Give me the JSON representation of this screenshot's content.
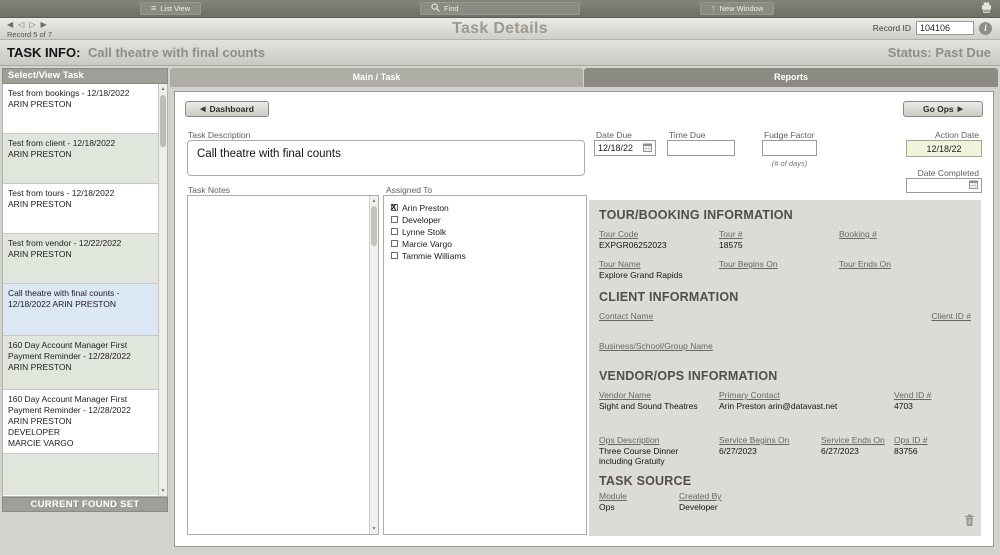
{
  "icons": {
    "list": "≡",
    "up_arrow": "↑",
    "back": "◀",
    "forward": "▶",
    "nav_first": "◀",
    "nav_prev": "◁",
    "nav_next": "▷",
    "nav_last": "▶",
    "scroll_up": "▲",
    "scroll_down": "▼",
    "info": "i"
  },
  "toolbar": {
    "list_view": "List View",
    "find": "Find",
    "new_window": "New Window"
  },
  "header": {
    "record_nav": "Record 5 of 7",
    "title": "Task Details",
    "record_id_label": "Record ID",
    "record_id": "104106"
  },
  "task_info": {
    "label": "TASK INFO:",
    "value": "Call theatre with final counts",
    "status": "Status: Past Due"
  },
  "sidebar": {
    "header": "Select/View Task",
    "footer": "CURRENT FOUND SET",
    "items": [
      {
        "text": "Test from bookings - 12/18/2022\nARIN PRESTON",
        "selected": false
      },
      {
        "text": "Test from client - 12/18/2022\nARIN PRESTON",
        "selected": false
      },
      {
        "text": "Test from tours - 12/18/2022\nARIN PRESTON",
        "selected": false
      },
      {
        "text": "Test from vendor - 12/22/2022\nARIN PRESTON",
        "selected": false
      },
      {
        "text": "Call theatre with final counts - 12/18/2022 ARIN PRESTON",
        "selected": true
      },
      {
        "text": "160 Day Account Manager First Payment Reminder - 12/28/2022\nARIN PRESTON",
        "selected": false
      },
      {
        "text": "160 Day Account Manager First Payment Reminder - 12/28/2022\nARIN PRESTON\nDEVELOPER\nMARCIE VARGO",
        "selected": false
      }
    ]
  },
  "tabs": {
    "main": "Main / Task",
    "reports": "Reports"
  },
  "actions": {
    "dashboard": "Dashboard",
    "go_ops": "Go Ops"
  },
  "form": {
    "task_description_label": "Task Description",
    "task_description": "Call theatre with final counts",
    "task_notes_label": "Task Notes",
    "assigned_to_label": "Assigned To",
    "assignees": [
      {
        "name": "Arin Preston",
        "checked": true
      },
      {
        "name": "Developer",
        "checked": false
      },
      {
        "name": "Lynne Stolk",
        "checked": false
      },
      {
        "name": "Marcie Vargo",
        "checked": false
      },
      {
        "name": "Tammie Williams",
        "checked": false
      }
    ],
    "date_due_label": "Date Due",
    "date_due": "12/18/22",
    "time_due_label": "Time Due",
    "time_due": "",
    "fudge_factor_label": "Fudge Factor",
    "fudge_factor": "",
    "fudge_note": "(# of days)",
    "action_date_label": "Action Date",
    "action_date": "12/18/22",
    "date_completed_label": "Date Completed",
    "date_completed": ""
  },
  "tour_booking": {
    "heading": "TOUR/BOOKING INFORMATION",
    "tour_code_label": "Tour Code",
    "tour_code": "EXPGR06252023",
    "tour_num_label": "Tour #",
    "tour_num": "18575",
    "booking_num_label": "Booking #",
    "booking_num": "",
    "tour_name_label": "Tour Name",
    "tour_name": "Explore Grand Rapids",
    "tour_begins_label": "Tour Begins On",
    "tour_begins": "",
    "tour_ends_label": "Tour Ends On",
    "tour_ends": ""
  },
  "client": {
    "heading": "CLIENT INFORMATION",
    "contact_name_label": "Contact Name",
    "client_id_label": "Client ID #",
    "business_label": "Business/School/Group Name"
  },
  "vendor_ops": {
    "heading": "VENDOR/OPS INFORMATION",
    "vendor_name_label": "Vendor Name",
    "vendor_name": "Sight and Sound Theatres",
    "primary_contact_label": "Primary Contact",
    "primary_contact": "Arin Preston arin@datavast.net",
    "vend_id_label": "Vend ID #",
    "vend_id": "4703",
    "ops_desc_label": "Ops Description",
    "ops_desc": "Three Course Dinner including Gratuity",
    "service_begins_label": "Service Begins On",
    "service_begins": "6/27/2023",
    "service_ends_label": "Service Ends On",
    "service_ends": "6/27/2023",
    "ops_id_label": "Ops ID #",
    "ops_id": "83756"
  },
  "task_source": {
    "heading": "TASK SOURCE",
    "module_label": "Module",
    "module": "Ops",
    "created_by_label": "Created By",
    "created_by": "Developer"
  }
}
